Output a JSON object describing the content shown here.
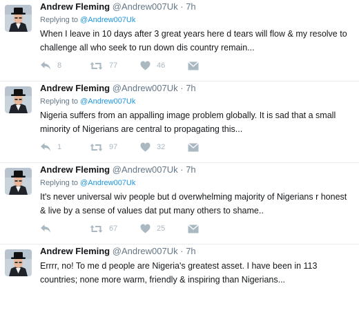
{
  "tweets": [
    {
      "name": "Andrew Fleming",
      "handle": "@Andrew007Uk",
      "separator": "·",
      "time": "7h",
      "replying_prefix": "Replying to",
      "replying_to": "@Andrew007Uk",
      "text": "When I leave in 10 days after 3 great years here d tears will flow & my resolve to challenge all who seek to run down dis country remain...",
      "replies": "8",
      "retweets": "77",
      "likes": "46"
    },
    {
      "name": "Andrew Fleming",
      "handle": "@Andrew007Uk",
      "separator": "·",
      "time": "7h",
      "replying_prefix": "Replying to",
      "replying_to": "@Andrew007Uk",
      "text": "Nigeria suffers from an appalling image problem globally. It is sad that a small minority of Nigerians are central to propagating this...",
      "replies": "1",
      "retweets": "97",
      "likes": "32"
    },
    {
      "name": "Andrew Fleming",
      "handle": "@Andrew007Uk",
      "separator": "·",
      "time": "7h",
      "replying_prefix": "Replying to",
      "replying_to": "@Andrew007Uk",
      "text": "It's never universal wiv people but d overwhelming majority of Nigerians r honest & live by a sense of values dat put many others to shame..",
      "replies": "",
      "retweets": "67",
      "likes": "25"
    },
    {
      "name": "Andrew Fleming",
      "handle": "@Andrew007Uk",
      "separator": "·",
      "time": "7h",
      "replying_prefix": "",
      "replying_to": "",
      "text": "Errrr, no! To me d people are Nigeria's greatest asset. I have been in 113 countries; none more warm, friendly & inspiring than Nigerians...",
      "replies": "",
      "retweets": "",
      "likes": ""
    }
  ],
  "icons": {
    "reply": "reply-icon",
    "retweet": "retweet-icon",
    "like": "heart-icon",
    "dm": "envelope-icon",
    "avatar": "profile-photo"
  },
  "colors": {
    "mention": "#1b95e0",
    "muted": "#657786",
    "action_icon": "#aab8c2",
    "divider": "#e6ecf0"
  }
}
